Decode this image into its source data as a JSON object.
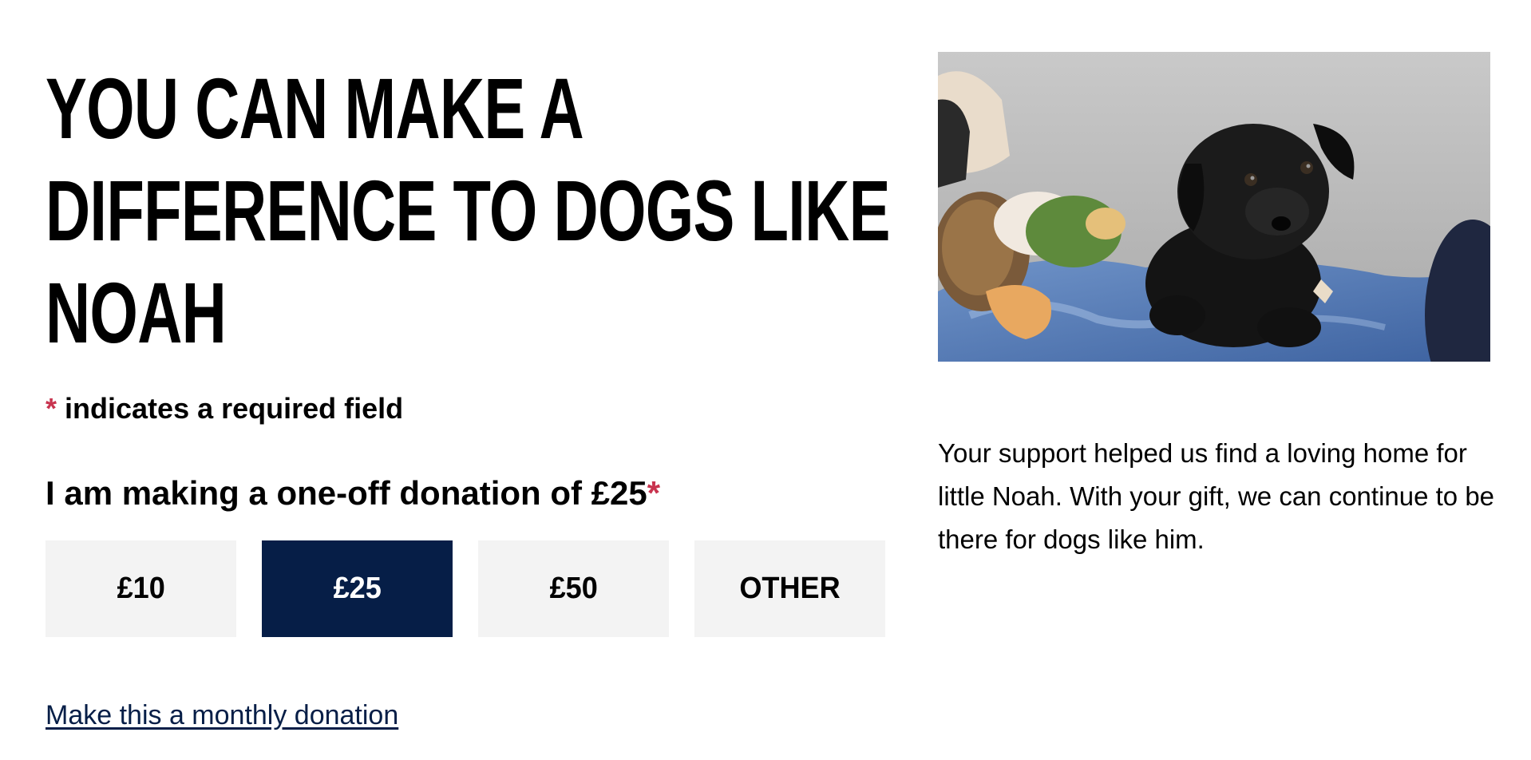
{
  "heading": {
    "line1": "YOU CAN MAKE A",
    "line2": "DIFFERENCE TO DOGS LIKE",
    "line3": "NOAH"
  },
  "required_note": {
    "asterisk": "*",
    "text": "indicates a required field"
  },
  "donation": {
    "label": "I am making a one-off donation of £25",
    "required_marker": "*",
    "amounts": [
      {
        "label": "£10",
        "selected": false
      },
      {
        "label": "£25",
        "selected": true
      },
      {
        "label": "£50",
        "selected": false
      },
      {
        "label": "OTHER",
        "selected": false
      }
    ],
    "monthly_link": "Make this a monthly donation"
  },
  "side_text": "Your support helped us find a loving home for little Noah. With your gift, we can continue to be there for dogs like him.",
  "colors": {
    "accent_navy": "#061e47",
    "required_red": "#c8344f",
    "button_grey": "#f3f3f3"
  }
}
